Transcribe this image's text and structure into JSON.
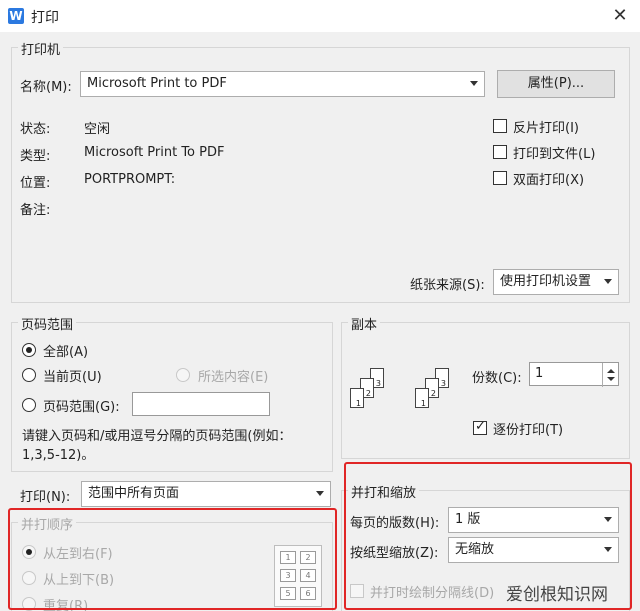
{
  "window": {
    "title": "打印",
    "app_icon_letter": "W",
    "close_glyph": "✕"
  },
  "printer": {
    "group_label": "打印机",
    "name_label": "名称(M):",
    "name_value": "Microsoft Print to PDF",
    "properties_button": "属性(P)...",
    "status_label": "状态:",
    "status_value": "空闲",
    "type_label": "类型:",
    "type_value": "Microsoft Print To PDF",
    "location_label": "位置:",
    "location_value": "PORTPROMPT:",
    "comment_label": "备注:",
    "reverse_print": "反片打印(I)",
    "print_to_file": "打印到文件(L)",
    "duplex_print": "双面打印(X)",
    "paper_source_label": "纸张来源(S):",
    "paper_source_value": "使用打印机设置"
  },
  "page_range": {
    "group_label": "页码范围",
    "all": "全部(A)",
    "current": "当前页(U)",
    "selection": "所选内容(E)",
    "pages": "页码范围(G):",
    "pages_value": "",
    "hint": "请键入页码和/或用逗号分隔的页码范围(例如：1,3,5-12)。"
  },
  "print_what": {
    "label": "打印(N):",
    "value": "范围中所有页面"
  },
  "copies": {
    "group_label": "副本",
    "count_label": "份数(C):",
    "count_value": "1",
    "collate": "逐份打印(T)"
  },
  "order": {
    "group_label": "并打顺序",
    "left_to_right": "从左到右(F)",
    "top_to_bottom": "从上到下(B)",
    "repeat": "重复(R)"
  },
  "zoom": {
    "group_label": "并打和缩放",
    "pages_per_sheet_label": "每页的版数(H):",
    "pages_per_sheet_value": "1 版",
    "scale_label": "按纸型缩放(Z):",
    "scale_value": "无缩放",
    "draw_separator": "并打时绘制分隔线(D)"
  },
  "watermark": "爱创根知识网",
  "colors": {
    "accent": "#2b79e0",
    "highlight_box": "#e02626"
  }
}
